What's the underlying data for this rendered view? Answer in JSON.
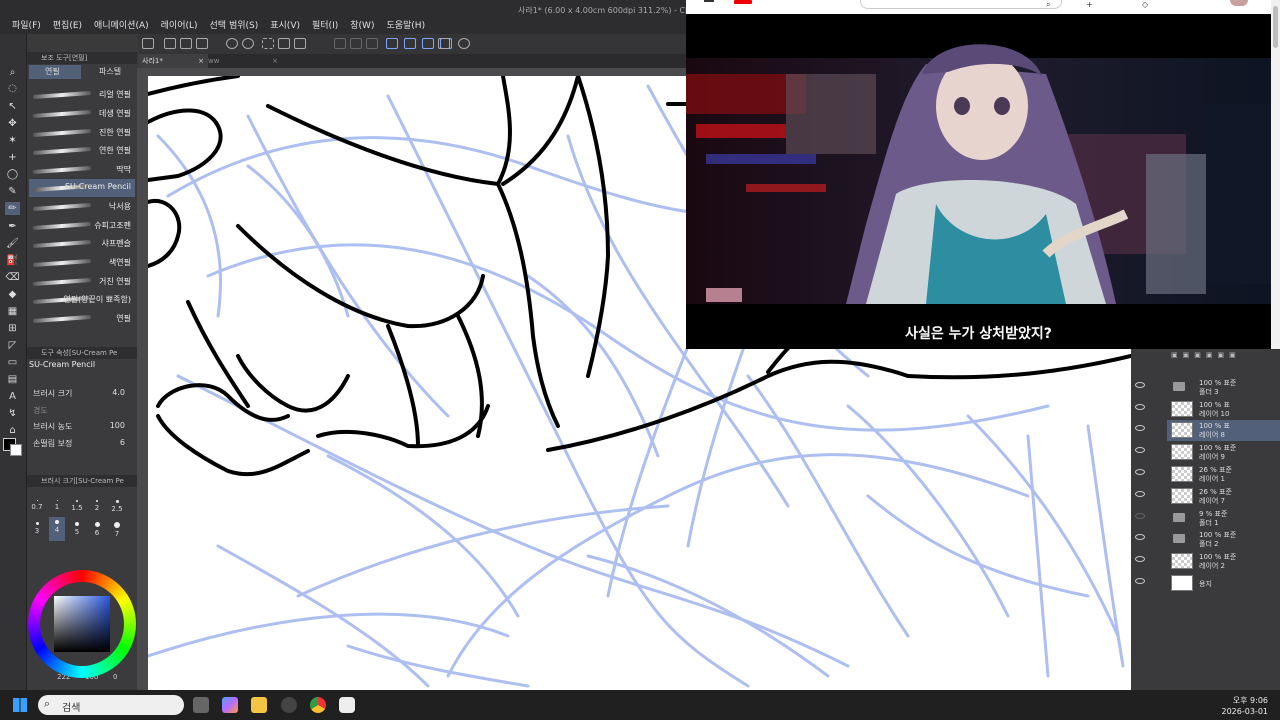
{
  "app": {
    "title": "사라1* (6.00 x 4.00cm 600dpi 311.2%) - CLI",
    "menus": [
      "파일(F)",
      "편집(E)",
      "애니메이션(A)",
      "레이어(L)",
      "선택 범위(S)",
      "표시(V)",
      "필터(I)",
      "창(W)",
      "도움말(H)"
    ],
    "canvas_tabs": [
      "사라1*",
      "ww"
    ]
  },
  "subtool": {
    "panel_title": "보조 도구[연필]",
    "tabs": [
      "연필",
      "파스텔"
    ],
    "brushes": [
      {
        "label": "리얼 연필"
      },
      {
        "label": "데생 연필"
      },
      {
        "label": "진한 연필"
      },
      {
        "label": "연한 연필"
      },
      {
        "label": "딱딱"
      },
      {
        "label": "SU-Cream Pencil"
      },
      {
        "label": "낙서용"
      },
      {
        "label": "슈피고조펜"
      },
      {
        "label": "샤프펜슬"
      },
      {
        "label": "색연필"
      },
      {
        "label": "거친 연필"
      },
      {
        "label": "연필(양끝이 뾰족함)"
      },
      {
        "label": "연필"
      }
    ],
    "selected_brush": "SU-Cream Pencil"
  },
  "tool_property": {
    "panel_title": "도구 속성[SU-Cream Pe",
    "brush_name": "SU-Cream Pencil",
    "rows": [
      {
        "label": "브러시 크기",
        "value": "4.0"
      },
      {
        "label": "경도",
        "value": ""
      },
      {
        "label": "브러시 농도",
        "value": "100"
      },
      {
        "label": "손떨림 보정",
        "value": "6"
      }
    ]
  },
  "brush_size": {
    "panel_title": "브러시 크기[SU-Cream Pe",
    "sizes": [
      "0.7",
      "1",
      "1.5",
      "2",
      "2.5",
      "3",
      "4",
      "5",
      "6",
      "7"
    ],
    "selected": "4"
  },
  "color": {
    "rgb_readout": "222",
    "opacity_readout": "100",
    "zero": "0"
  },
  "youtube": {
    "subtitle": "사실은 누가 상처받았지?"
  },
  "layers": [
    {
      "line1": "100 % 표준",
      "line2": "폴더 3",
      "type": "folder"
    },
    {
      "line1": "100 % 표",
      "line2": "레이어 10",
      "type": "layer"
    },
    {
      "line1": "100 % 표",
      "line2": "레이어 8",
      "type": "layer",
      "selected": true
    },
    {
      "line1": "100 % 표준",
      "line2": "레이어 9",
      "type": "layer"
    },
    {
      "line1": "26 % 표준",
      "line2": "레이어 1",
      "type": "layer"
    },
    {
      "line1": "26 % 표준",
      "line2": "레이어 7",
      "type": "layer"
    },
    {
      "line1": "9 % 표준",
      "line2": "폴더 1",
      "type": "folder"
    },
    {
      "line1": "100 % 표준",
      "line2": "폴더 2",
      "type": "folder"
    },
    {
      "line1": "100 % 표준",
      "line2": "레이어 2",
      "type": "layer"
    },
    {
      "line1": "",
      "line2": "용지",
      "type": "paper"
    }
  ],
  "taskbar": {
    "search_placeholder": "검색",
    "time": "오후 9:06",
    "date": "2026-03-01"
  },
  "colors": {
    "sketch_blue": "#9fb4ef",
    "ink": "#000000",
    "selection": "#52607a"
  }
}
